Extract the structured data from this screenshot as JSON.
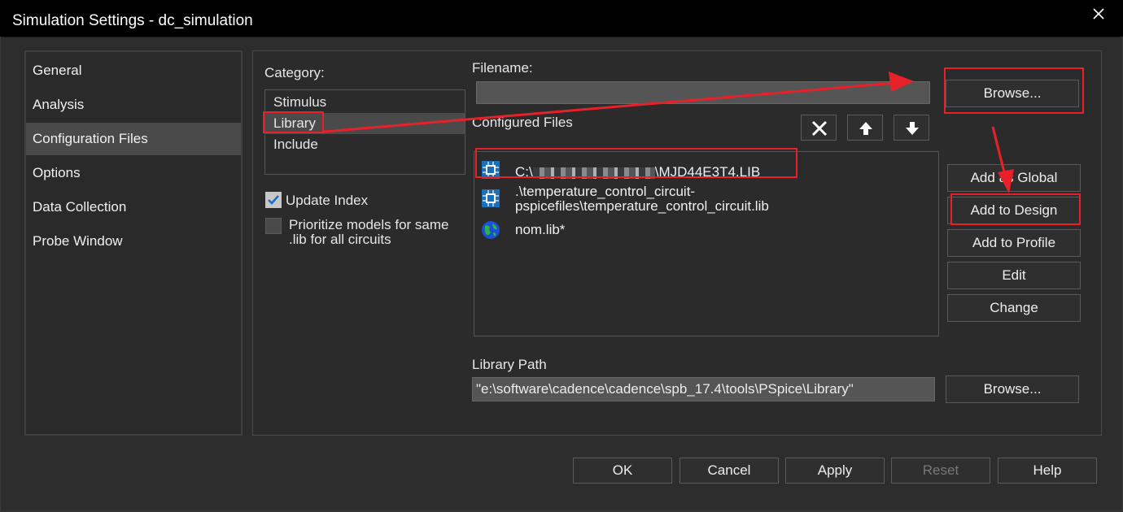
{
  "window": {
    "title": "Simulation Settings - dc_simulation"
  },
  "nav": {
    "items": [
      {
        "label": "General"
      },
      {
        "label": "Analysis"
      },
      {
        "label": "Configuration Files",
        "selected": true
      },
      {
        "label": "Options"
      },
      {
        "label": "Data Collection"
      },
      {
        "label": "Probe Window"
      }
    ]
  },
  "category": {
    "label": "Category:",
    "items": [
      {
        "label": "Stimulus"
      },
      {
        "label": "Library",
        "selected": true
      },
      {
        "label": "Include"
      }
    ]
  },
  "checkboxes": {
    "update_index": {
      "label": "Update Index",
      "checked": true
    },
    "prioritize": {
      "label_line1": "Prioritize models for same",
      "label_line2": ".lib for all circuits",
      "checked": false
    }
  },
  "filename": {
    "label": "Filename:",
    "value": ""
  },
  "configured_files": {
    "label": "Configured Files",
    "files": [
      {
        "prefix": "C:\\",
        "suffix": "\\MJD44E3T4.LIB",
        "icon": "chip-icon"
      },
      {
        "line1": ".\\temperature_control_circuit-",
        "line2": "pspicefiles\\temperature_control_circuit.lib",
        "icon": "chip-icon"
      },
      {
        "text": "nom.lib*",
        "icon": "globe-icon"
      }
    ]
  },
  "buttons": {
    "browse_file": "Browse...",
    "add_global": "Add as Global",
    "add_design": "Add to Design",
    "add_profile": "Add to Profile",
    "edit": "Edit",
    "change": "Change",
    "browse_path": "Browse...",
    "ok": "OK",
    "cancel": "Cancel",
    "apply": "Apply",
    "reset": "Reset",
    "help": "Help"
  },
  "library_path": {
    "label": "Library Path",
    "value": "\"e:\\software\\cadence\\cadence\\spb_17.4\\tools\\PSpice\\Library\""
  },
  "colors": {
    "annotation": "#e8202a",
    "selected_bg": "#4a4a4a",
    "title_bg": "#000000"
  }
}
